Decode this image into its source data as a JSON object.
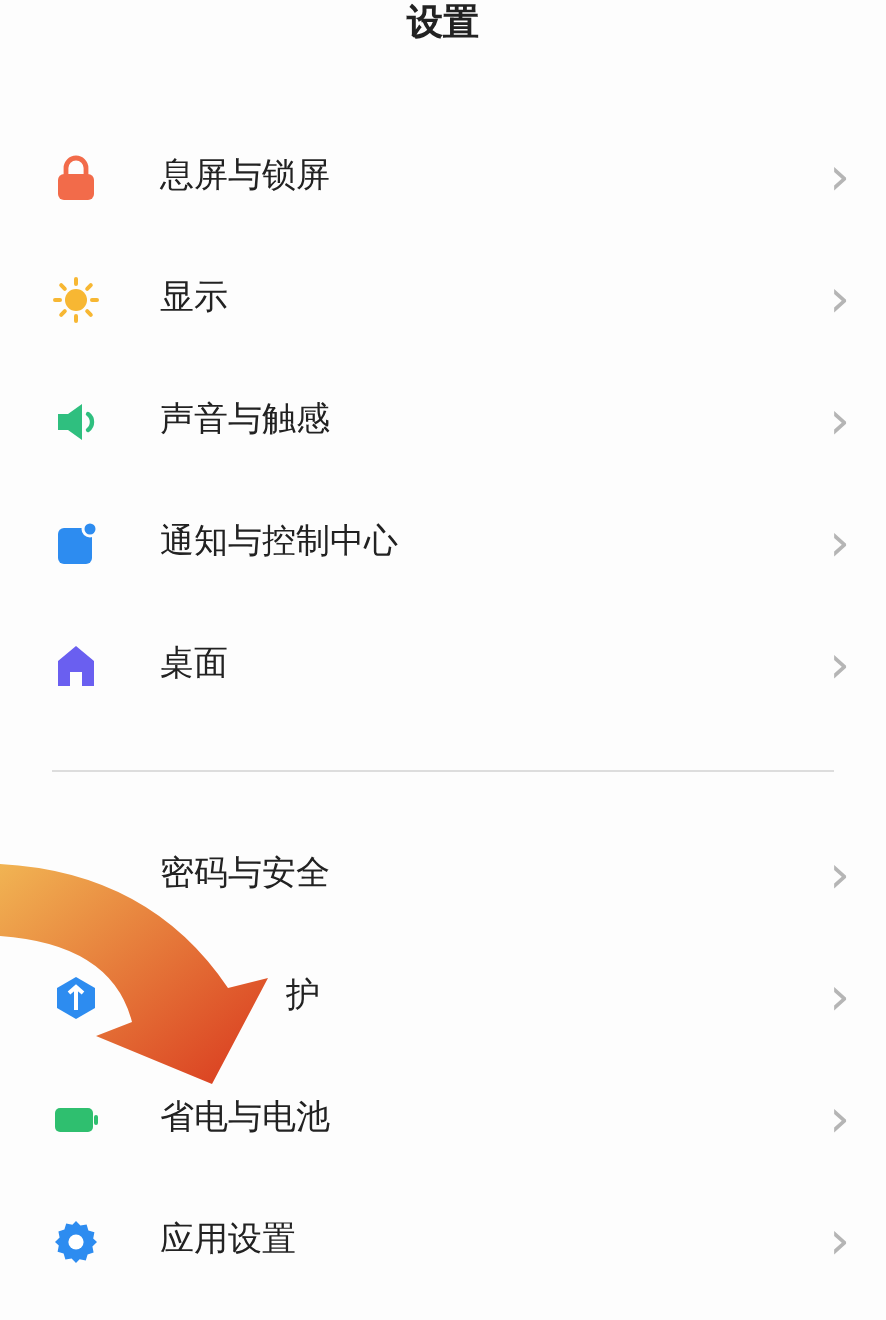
{
  "title": "设置",
  "groups": [
    {
      "items": [
        {
          "label": "息屏与锁屏",
          "color": "#f26b4a",
          "chevron": "›"
        },
        {
          "label": "显示",
          "color": "#f7b733",
          "chevron": "›"
        },
        {
          "label": "声音与触感",
          "color": "#2fbf7f",
          "chevron": "›"
        },
        {
          "label": "通知与控制中心",
          "color": "#2d8cf0",
          "chevron": "›"
        },
        {
          "label": "桌面",
          "color": "#6a5ff0",
          "chevron": "›"
        }
      ]
    },
    {
      "items": [
        {
          "label": "密码与安全",
          "chevron": "›"
        },
        {
          "label": "护",
          "color": "#2d8cf0",
          "covered": true,
          "chevron": "›"
        },
        {
          "label": "省电与电池",
          "color": "#2fbf6f",
          "chevron": "›"
        },
        {
          "label": "应用设置",
          "color": "#2d8cf0",
          "chevron": "›"
        }
      ]
    }
  ]
}
